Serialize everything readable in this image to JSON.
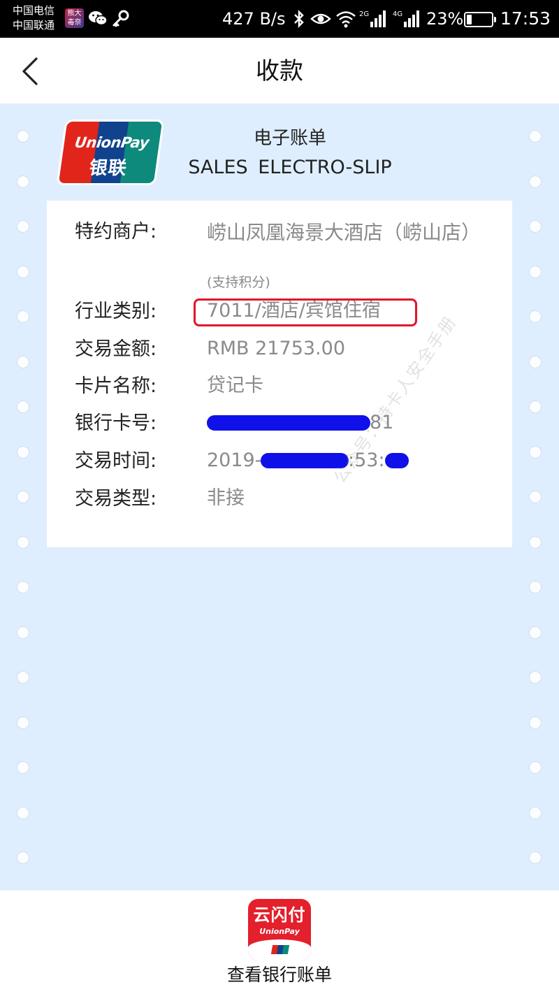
{
  "status_bar": {
    "carrier_1": "中国电信",
    "carrier_2": "中国联通",
    "app_icon_text_1": "熊大",
    "app_icon_text_2": "毒奈",
    "net_speed": "427 B/s",
    "signal_2g_label": "2G",
    "signal_4g_label": "4G",
    "battery": "23%",
    "time": "17:53"
  },
  "header": {
    "title": "收款"
  },
  "slip": {
    "logo_text": "UnionPay",
    "logo_text_cn": "银联",
    "title_cn": "电子账单",
    "title_en": "SALES  ELECTRO-SLIP"
  },
  "details": {
    "merchant_label": "特约商户:",
    "merchant_value": "崂山凤凰海景大酒店（崂山店）",
    "merchant_note": "(支持积分)",
    "industry_label": "行业类别:",
    "industry_value": "7011/酒店/宾馆住宿",
    "amount_label": "交易金额:",
    "amount_value": "RMB  21753.00",
    "card_name_label": "卡片名称:",
    "card_name_value": "贷记卡",
    "card_no_label": "银行卡号:",
    "card_no_suffix": "81",
    "time_label": "交易时间:",
    "time_prefix": "2019-",
    "time_middle": ":53:",
    "type_label": "交易类型:",
    "type_value": "非接"
  },
  "watermark": "公众号：持卡人安全手册",
  "bottom": {
    "app_name": "云闪付",
    "app_sub": "UnionPay",
    "label": "查看银行账单"
  },
  "colors": {
    "background": "#dfeefe",
    "highlight": "#e3142a",
    "redaction": "#1010e8",
    "app_red": "#e3202c"
  }
}
